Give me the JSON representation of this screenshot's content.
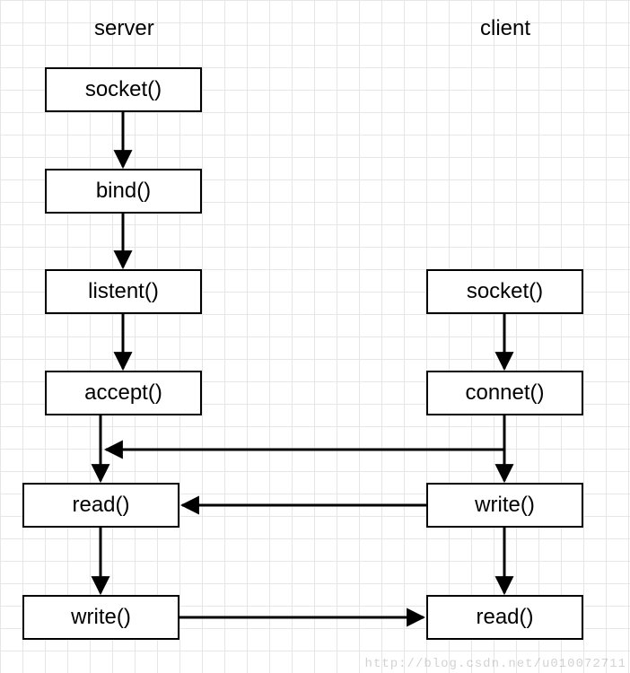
{
  "titles": {
    "server": "server",
    "client": "client"
  },
  "server_nodes": {
    "socket": "socket()",
    "bind": "bind()",
    "listen": "listent()",
    "accept": "accept()",
    "read": "read()",
    "write": "write()"
  },
  "client_nodes": {
    "socket": "socket()",
    "connect": "connet()",
    "write": "write()",
    "read": "read()"
  },
  "watermark": "http://blog.csdn.net/u010072711",
  "chart_data": {
    "type": "flowchart",
    "columns": [
      {
        "name": "server",
        "label": "server"
      },
      {
        "name": "client",
        "label": "client"
      }
    ],
    "nodes": [
      {
        "id": "s_socket",
        "column": "server",
        "label": "socket()"
      },
      {
        "id": "s_bind",
        "column": "server",
        "label": "bind()"
      },
      {
        "id": "s_listen",
        "column": "server",
        "label": "listent()"
      },
      {
        "id": "s_accept",
        "column": "server",
        "label": "accept()"
      },
      {
        "id": "s_read",
        "column": "server",
        "label": "read()"
      },
      {
        "id": "s_write",
        "column": "server",
        "label": "write()"
      },
      {
        "id": "c_socket",
        "column": "client",
        "label": "socket()"
      },
      {
        "id": "c_connect",
        "column": "client",
        "label": "connet()"
      },
      {
        "id": "c_write",
        "column": "client",
        "label": "write()"
      },
      {
        "id": "c_read",
        "column": "client",
        "label": "read()"
      }
    ],
    "edges": [
      {
        "from": "s_socket",
        "to": "s_bind"
      },
      {
        "from": "s_bind",
        "to": "s_listen"
      },
      {
        "from": "s_listen",
        "to": "s_accept"
      },
      {
        "from": "s_accept",
        "to": "s_read"
      },
      {
        "from": "s_read",
        "to": "s_write"
      },
      {
        "from": "c_socket",
        "to": "c_connect"
      },
      {
        "from": "c_connect",
        "to": "c_write"
      },
      {
        "from": "c_write",
        "to": "c_read"
      },
      {
        "from": "c_connect",
        "to": "s_accept",
        "note": "connect to accept"
      },
      {
        "from": "c_write",
        "to": "s_read"
      },
      {
        "from": "s_write",
        "to": "c_read"
      }
    ]
  }
}
